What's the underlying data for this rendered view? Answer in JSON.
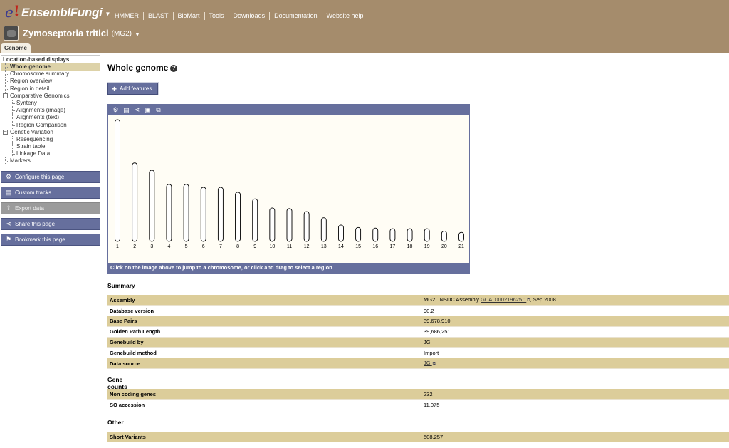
{
  "header": {
    "brand": "EnsemblFungi",
    "nav": [
      "HMMER",
      "BLAST",
      "BioMart",
      "Tools",
      "Downloads",
      "Documentation",
      "Website help"
    ],
    "species": "Zymoseptoria tritici",
    "strain": "(MG2)",
    "tab": "Genome"
  },
  "sidebar": {
    "heading": "Location-based displays",
    "items": [
      {
        "label": "Whole genome",
        "level": 1,
        "active": true
      },
      {
        "label": "Chromosome summary",
        "level": 1
      },
      {
        "label": "Region overview",
        "level": 1
      },
      {
        "label": "Region in detail",
        "level": 1
      },
      {
        "label": "Comparative Genomics",
        "level": 1,
        "expander": "−"
      },
      {
        "label": "Synteny",
        "level": 2
      },
      {
        "label": "Alignments (image)",
        "level": 2
      },
      {
        "label": "Alignments (text)",
        "level": 2
      },
      {
        "label": "Region Comparison",
        "level": 2
      },
      {
        "label": "Genetic Variation",
        "level": 1,
        "expander": "−"
      },
      {
        "label": "Resequencing",
        "level": 2
      },
      {
        "label": "Strain table",
        "level": 2
      },
      {
        "label": "Linkage Data",
        "level": 2
      },
      {
        "label": "Markers",
        "level": 1
      }
    ],
    "buttons": [
      {
        "label": "Configure this page",
        "icon": "gear-icon",
        "glyph": "⚙"
      },
      {
        "label": "Custom tracks",
        "icon": "custom-tracks-icon",
        "glyph": "▤"
      },
      {
        "label": "Export data",
        "icon": "export-icon",
        "glyph": "⇪",
        "disabled": true
      },
      {
        "label": "Share this page",
        "icon": "share-icon",
        "glyph": "⋖"
      },
      {
        "label": "Bookmark this page",
        "icon": "bookmark-icon",
        "glyph": "⚑"
      }
    ]
  },
  "main": {
    "title": "Whole genome",
    "add_features": "Add features",
    "karyotype": {
      "toolbar_icons": [
        {
          "name": "gear-icon",
          "glyph": "⚙"
        },
        {
          "name": "custom-tracks-icon",
          "glyph": "▤"
        },
        {
          "name": "share-icon",
          "glyph": "⋖"
        },
        {
          "name": "image-icon",
          "glyph": "▣"
        },
        {
          "name": "resize-icon",
          "glyph": "⧉"
        }
      ],
      "chromosomes": [
        {
          "label": "1",
          "length": 1.0
        },
        {
          "label": "2",
          "length": 0.645
        },
        {
          "label": "3",
          "length": 0.585
        },
        {
          "label": "4",
          "length": 0.47
        },
        {
          "label": "5",
          "length": 0.47
        },
        {
          "label": "6",
          "length": 0.445
        },
        {
          "label": "7",
          "length": 0.445
        },
        {
          "label": "8",
          "length": 0.405
        },
        {
          "label": "9",
          "length": 0.35
        },
        {
          "label": "10",
          "length": 0.275
        },
        {
          "label": "11",
          "length": 0.27
        },
        {
          "label": "12",
          "length": 0.245
        },
        {
          "label": "13",
          "length": 0.195
        },
        {
          "label": "14",
          "length": 0.135
        },
        {
          "label": "15",
          "length": 0.115
        },
        {
          "label": "16",
          "length": 0.11
        },
        {
          "label": "17",
          "length": 0.105
        },
        {
          "label": "18",
          "length": 0.105
        },
        {
          "label": "19",
          "length": 0.105
        },
        {
          "label": "20",
          "length": 0.085
        },
        {
          "label": "21",
          "length": 0.075
        }
      ],
      "caption": "Click on the image above to jump to a chromosome, or click and drag to select a region"
    },
    "summary": {
      "title": "Summary",
      "assembly_key": "Assembly",
      "assembly_prefix": "MG2, INSDC Assembly ",
      "assembly_link": "GCA_000219625.1",
      "assembly_suffix": ", Sep 2008",
      "database_version_key": "Database version",
      "database_version": "90.2",
      "base_pairs_key": "Base Pairs",
      "base_pairs": "39,678,910",
      "golden_path_key": "Golden Path Length",
      "golden_path": "39,686,251",
      "genebuild_by_key": "Genebuild by",
      "genebuild_by": "JGI",
      "genebuild_method_key": "Genebuild method",
      "genebuild_method": "Import",
      "data_source_key": "Data source",
      "data_source": "JGI"
    },
    "gene_counts": {
      "title": "Gene counts",
      "rows": [
        {
          "key": "Non coding genes",
          "value": "232"
        },
        {
          "key": "SO accession",
          "value": "11,075"
        }
      ]
    },
    "other": {
      "title": "Other",
      "rows": [
        {
          "key": "Short Variants",
          "value": "508,257"
        }
      ]
    }
  }
}
